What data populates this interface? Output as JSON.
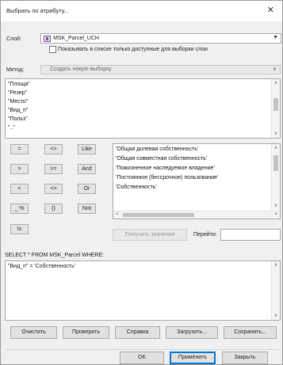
{
  "window": {
    "title": "Выбрать по атрибуту...",
    "close_glyph": "✕"
  },
  "layer": {
    "label": "Слой:",
    "value": "MSK_Parcel_UCH",
    "show_selectable_only_label": "Показывать в списке только доступные для выборки слои",
    "show_selectable_only_checked": false
  },
  "method": {
    "label": "Метод:",
    "value": "Создать новую выборку"
  },
  "fields": [
    "\"Площа\"",
    "\"Резер\"",
    "\"Место\"",
    "\"Вид_п\"",
    "\"Польз\"",
    "\"..\""
  ],
  "operators": [
    [
      "=",
      "<>",
      "Like"
    ],
    [
      ">",
      ">=",
      "And"
    ],
    [
      "<",
      "<=",
      "Or"
    ],
    [
      "_ %",
      "()",
      "Not"
    ]
  ],
  "is_label": "Is",
  "values": [
    "'Общая долевая собственность'",
    "'Общая совместная собственность'",
    "'Пожизненное наследуемое владение'",
    "'Постоянное (бессрочное) пользование'",
    "'Собственность'"
  ],
  "get_unique_label": "Получить значения",
  "goto_label": "Перейти:",
  "goto_value": "",
  "sql_prefix": "SELECT * FROM MSK_Parcel WHERE:",
  "expression": "\"Вид_п\" = 'Собственность'",
  "actions": {
    "clear": "Очистить",
    "verify": "Проверить",
    "help": "Справка",
    "load": "Загрузить...",
    "save": "Сохранить..."
  },
  "footer": {
    "ok": "OK",
    "apply": "Применить",
    "close": "Закрыть"
  },
  "icons": {
    "layer": "layer-icon",
    "dropdown": "chevron-down-icon"
  },
  "colors": {
    "default_button_border": "#0078d7",
    "dialog_background": "#f0f0f0"
  }
}
